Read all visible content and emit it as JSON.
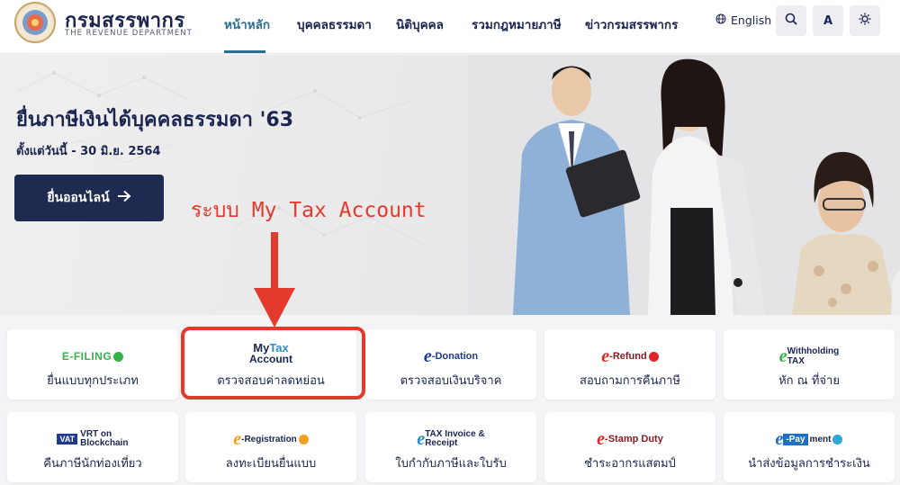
{
  "header": {
    "logo_th": "กรมสรรพากร",
    "logo_en": "THE REVENUE DEPARTMENT",
    "nav": [
      {
        "label": "หน้าหลัก",
        "active": true
      },
      {
        "label": "บุคคลธรรมดา",
        "active": false
      },
      {
        "label": "นิติบุคคล",
        "active": false
      },
      {
        "label": "รวมกฎหมายภาษี",
        "active": false
      },
      {
        "label": "ข่าวกรมสรรพากร",
        "active": false
      }
    ],
    "language_label": "English",
    "font_size_label": "A",
    "icons": {
      "language": "globe-icon",
      "search": "search-icon",
      "contrast": "brightness-icon"
    }
  },
  "hero": {
    "title": "ยื่นภาษีเงินได้บุคคลธรรมดา '63",
    "subtitle": "ตั้งแต่วันนี้ - 30 มิ.ย. 2564",
    "cta_label": "ยื่นออนไลน์",
    "cta_icon": "arrow-right-icon"
  },
  "annotation": {
    "text": "ระบบ My Tax Account",
    "color": "#e43a2d"
  },
  "services": [
    {
      "logo_text": "E-FILING",
      "label": "ยื่นแบบทุกประเภท"
    },
    {
      "logo_text_1": "My",
      "logo_text_2": "Tax",
      "logo_text_3": "Account",
      "label": "ตรวจสอบค่าลดหย่อน"
    },
    {
      "logo_text": "-Donation",
      "label": "ตรวจสอบเงินบริจาค"
    },
    {
      "logo_text": "-Refund",
      "label": "สอบถามการคืนภาษี"
    },
    {
      "logo_text_1": "Withholding",
      "logo_text_2": "TAX",
      "label": "หัก ณ ที่จ่าย"
    },
    {
      "logo_text_1": "VAT",
      "logo_text_2": "VRT on",
      "logo_text_3": "Blockchain",
      "label": "คืนภาษีนักท่องเที่ยว"
    },
    {
      "logo_text": "-Registration",
      "label": "ลงทะเบียนยื่นแบบ"
    },
    {
      "logo_text_1": "TAX Invoice &",
      "logo_text_2": "Receipt",
      "label": "ใบกำกับภาษีและใบรับ"
    },
    {
      "logo_text": "-Stamp Duty",
      "label": "ชำระอากรแสตมป์"
    },
    {
      "logo_text_1": "-Pay",
      "logo_text_2": "ment",
      "label": "นำส่งข้อมูลการชำระเงิน"
    }
  ],
  "colors": {
    "navy": "#1b2550",
    "accent_teal": "#2c6f8f",
    "efiling_green": "#35b34a",
    "eservice_red": "#e0262b",
    "eservice_blue": "#1e88c8",
    "annotation_red": "#e43a2d"
  }
}
